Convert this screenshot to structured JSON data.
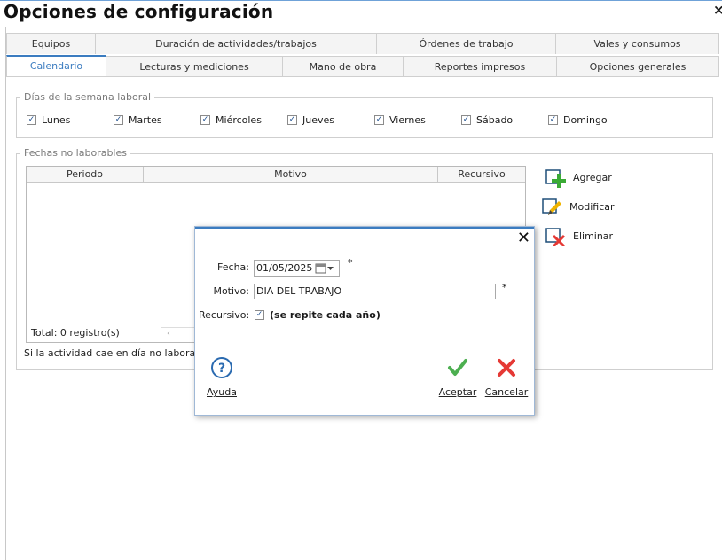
{
  "window": {
    "title": "Opciones de configuración",
    "close_glyph": "×"
  },
  "tabs": {
    "row1": [
      {
        "label": "Equipos"
      },
      {
        "label": "Duración de actividades/trabajos"
      },
      {
        "label": "Órdenes de trabajo"
      },
      {
        "label": "Vales y consumos"
      }
    ],
    "row2": [
      {
        "label": "Calendario",
        "active": true
      },
      {
        "label": "Lecturas y mediciones"
      },
      {
        "label": "Mano de obra"
      },
      {
        "label": "Reportes impresos"
      },
      {
        "label": "Opciones generales"
      }
    ]
  },
  "workweek": {
    "title": "Días de la semana laboral",
    "days": [
      {
        "label": "Lunes",
        "checked": true
      },
      {
        "label": "Martes",
        "checked": true
      },
      {
        "label": "Miércoles",
        "checked": true
      },
      {
        "label": "Jueves",
        "checked": true
      },
      {
        "label": "Viernes",
        "checked": true
      },
      {
        "label": "Sábado",
        "checked": true
      },
      {
        "label": "Domingo",
        "checked": true
      }
    ]
  },
  "holidays": {
    "title": "Fechas no laborables",
    "columns": [
      "Periodo",
      "Motivo",
      "Recursivo"
    ],
    "total": "Total: 0 registro(s)",
    "scroll_arrow": "‹",
    "note": "Si la actividad cae en día no laborable el",
    "buttons": {
      "add": "Agregar",
      "edit": "Modificar",
      "delete": "Eliminar"
    }
  },
  "dialog": {
    "close_glyph": "✕",
    "date_label": "Fecha:",
    "date_value": "01/05/2025",
    "reason_label": "Motivo:",
    "reason_value": "DIA DEL TRABAJO",
    "required_mark": "*",
    "recurring_label": "Recursivo:",
    "recurring_checked": true,
    "recurring_text": "(se repite cada año)",
    "help_label": "Ayuda",
    "accept_label": "Aceptar",
    "cancel_label": "Cancelar",
    "colors": {
      "accent": "#3b7cc0",
      "accept": "#4caf50",
      "cancel": "#e53935"
    }
  }
}
